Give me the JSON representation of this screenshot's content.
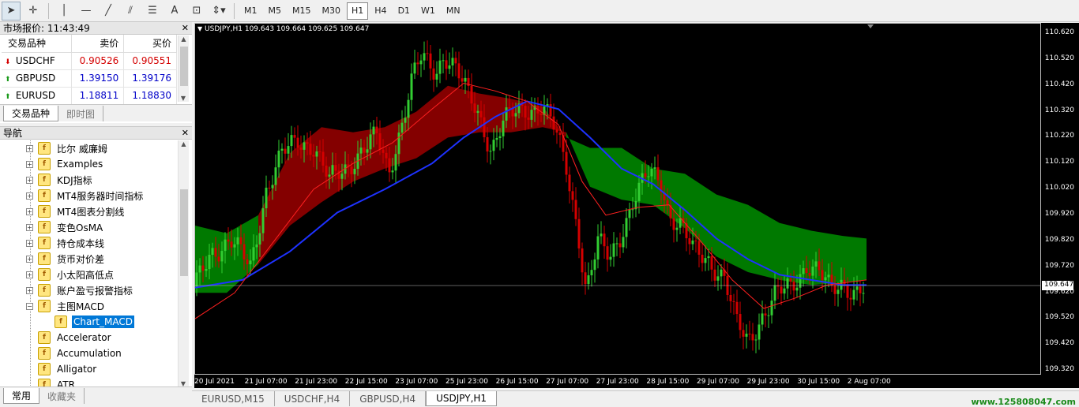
{
  "toolbar": {
    "timeframes": [
      "M1",
      "M5",
      "M15",
      "M30",
      "H1",
      "H4",
      "D1",
      "W1",
      "MN"
    ],
    "active_timeframe": "H1"
  },
  "market_watch": {
    "title": "市场报价: 11:43:49",
    "columns": [
      "交易品种",
      "卖价",
      "买价"
    ],
    "rows": [
      {
        "symbol": "USDCHF",
        "bid": "0.90526",
        "ask": "0.90551",
        "direction": "down",
        "color": "#d40000"
      },
      {
        "symbol": "GBPUSD",
        "bid": "1.39150",
        "ask": "1.39176",
        "direction": "up",
        "color": "#0000c8"
      },
      {
        "symbol": "EURUSD",
        "bid": "1.18811",
        "ask": "1.18830",
        "direction": "up",
        "color": "#0000c8"
      }
    ],
    "tabs": [
      "交易品种",
      "即时图"
    ]
  },
  "navigator": {
    "title": "导航",
    "items": [
      {
        "label": "比尔 威廉姆",
        "expandable": true
      },
      {
        "label": "Examples",
        "expandable": true
      },
      {
        "label": "KDJ指标",
        "expandable": true
      },
      {
        "label": "MT4服务器时间指标",
        "expandable": true
      },
      {
        "label": "MT4图表分割线",
        "expandable": true
      },
      {
        "label": "变色OsMA",
        "expandable": true
      },
      {
        "label": "持仓成本线",
        "expandable": true
      },
      {
        "label": "货币对价差",
        "expandable": true
      },
      {
        "label": "小太阳高低点",
        "expandable": true
      },
      {
        "label": "账户盈亏报警指标",
        "expandable": true
      },
      {
        "label": "主图MACD",
        "expandable": true,
        "expanded": true
      },
      {
        "label": "Chart_MACD",
        "child": true,
        "selected": true
      },
      {
        "label": "Accelerator",
        "expandable": false
      },
      {
        "label": "Accumulation",
        "expandable": false
      },
      {
        "label": "Alligator",
        "expandable": false
      },
      {
        "label": "ATR",
        "expandable": false
      }
    ],
    "tabs": [
      "常用",
      "收藏夹"
    ]
  },
  "chart": {
    "header": "USDJPY,H1  109.643 109.664 109.625 109.647",
    "current_price": "109.647",
    "price_labels": [
      "110.620",
      "110.520",
      "110.420",
      "110.320",
      "110.220",
      "110.120",
      "110.020",
      "109.920",
      "109.820",
      "109.720",
      "109.620",
      "109.520",
      "109.420",
      "109.320"
    ],
    "time_labels": [
      "20 Jul 2021",
      "21 Jul 07:00",
      "21 Jul 23:00",
      "22 Jul 15:00",
      "23 Jul 07:00",
      "25 Jul 23:00",
      "26 Jul 15:00",
      "27 Jul 07:00",
      "27 Jul 23:00",
      "28 Jul 15:00",
      "29 Jul 07:00",
      "29 Jul 23:00",
      "30 Jul 15:00",
      "2 Aug 07:00"
    ],
    "colors": {
      "up": "#32cd32",
      "down": "#d40000",
      "cloud_red": "#8b0000",
      "cloud_green": "#008000",
      "ma_blue": "#1e32ff",
      "ma_red": "#ff2020"
    }
  },
  "chart_tabs": [
    "EURUSD,M15",
    "USDCHF,H4",
    "GBPUSD,H4",
    "USDJPY,H1"
  ],
  "active_chart_tab": "USDJPY,H1",
  "watermark": "www.125808047.com"
}
